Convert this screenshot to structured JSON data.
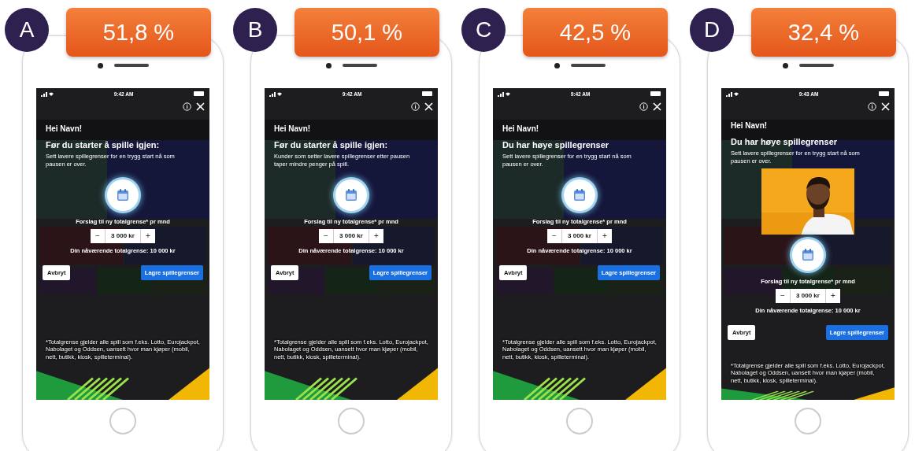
{
  "variants": [
    {
      "letter": "A",
      "score": "51,8 %",
      "time": "9:42 AM",
      "greeting": "Hei Navn!",
      "heading": "Før du starter å spille igjen:",
      "body": "Sett lavere spillegrenser for en trygg start nå som pausen er over.",
      "proposal_label": "Forslag til ny totalgrense* pr mnd",
      "stepper": {
        "minus": "−",
        "value": "3 000 kr",
        "plus": "+"
      },
      "current_limit": "Din nåværende totalgrense: 10 000 kr",
      "cancel": "Avbryt",
      "save": "Lagre spillegrenser",
      "footnote": "*Totalgrense gjelder alle spill som f.eks. Lotto, Eurojackpot, Nabolaget og Oddsen, uansett hvor man kjøper (mobil, nett, butikk, kiosk, spilleterminal)."
    },
    {
      "letter": "B",
      "score": "50,1 %",
      "time": "9:42 AM",
      "greeting": "Hei Navn!",
      "heading": "Før du starter å spille igjen:",
      "body": "Kunder som setter lavere spillegrenser etter pausen taper mindre penger på spill.",
      "proposal_label": "Forslag til ny totalgrense* pr mnd",
      "stepper": {
        "minus": "−",
        "value": "3 000 kr",
        "plus": "+"
      },
      "current_limit": "Din nåværende totalgrense: 10 000 kr",
      "cancel": "Avbryt",
      "save": "Lagre spillegrenser",
      "footnote": "*Totalgrense gjelder alle spill som f.eks. Lotto, Eurojackpot, Nabolaget og Oddsen, uansett hvor man kjøper (mobil, nett, butikk, kiosk, spilleterminal)."
    },
    {
      "letter": "C",
      "score": "42,5 %",
      "time": "9:42 AM",
      "greeting": "Hei Navn!",
      "heading": "Du har høye spillegrenser",
      "body": "Sett lavere spillegrenser for en trygg start nå som pausen er over.",
      "proposal_label": "Forslag til ny totalgrense* pr mnd",
      "stepper": {
        "minus": "−",
        "value": "3 000 kr",
        "plus": "+"
      },
      "current_limit": "Din nåværende totalgrense: 10 000 kr",
      "cancel": "Avbryt",
      "save": "Lagre spillegrenser",
      "footnote": "*Totalgrense gjelder alle spill som f.eks. Lotto, Eurojackpot, Nabolaget og Oddsen, uansett hvor man kjøper (mobil, nett, butikk, kiosk, spilleterminal)."
    },
    {
      "letter": "D",
      "score": "32,4 %",
      "time": "9:43 AM",
      "greeting": "Hei Navn!",
      "heading": "Du har høye spillegrenser",
      "body": "Sett lavere spillegrenser for en trygg start nå som pausen er over.",
      "proposal_label": "Forslag til ny totalgrense* pr mnd",
      "stepper": {
        "minus": "−",
        "value": "3 000 kr",
        "plus": "+"
      },
      "current_limit": "Din nåværende totalgrense: 10 000 kr",
      "cancel": "Avbryt",
      "save": "Lagre spillegrenser",
      "footnote": "*Totalgrense gjelder alle spill som f.eks. Lotto, Eurojackpot, Nabolaget og Oddsen, uansett hvor man kjøper (mobil, nett, butikk, kiosk, spilleterminal)."
    }
  ]
}
